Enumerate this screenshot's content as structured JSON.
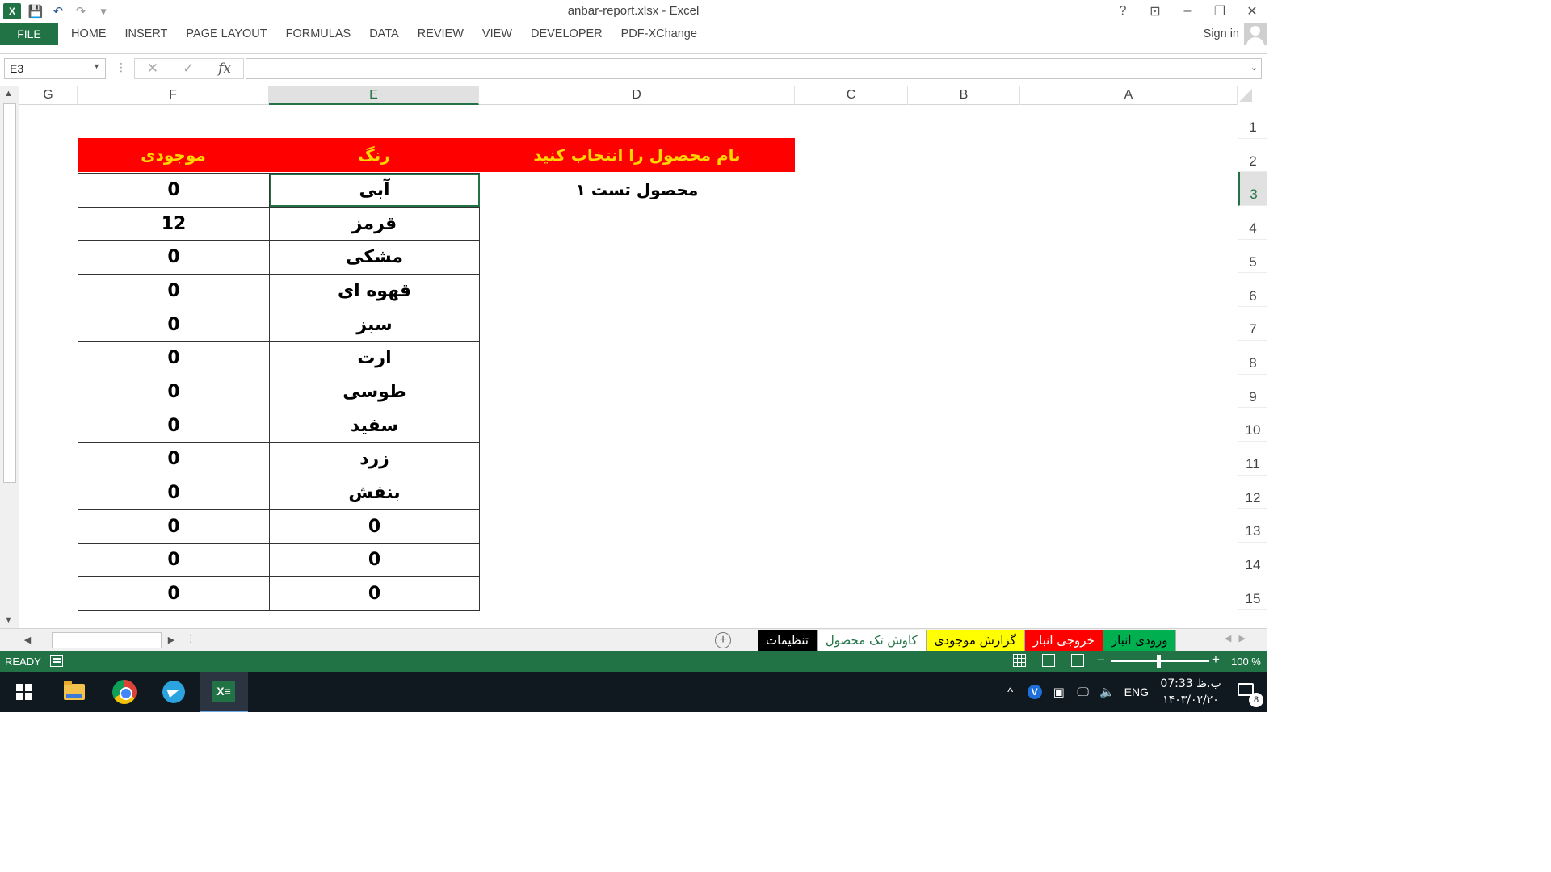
{
  "window": {
    "title": "anbar-report.xlsx - Excel",
    "help_icon": "?",
    "controls": [
      "ribbon-display-icon",
      "minimize-icon",
      "restore-icon",
      "close-icon"
    ]
  },
  "quick_access": {
    "app_icon_letter": "X",
    "save_icon": "💾",
    "undo_icon": "↶",
    "redo_icon": "↷",
    "customize_icon": "▾"
  },
  "ribbon": {
    "file_label": "FILE",
    "tabs": [
      "HOME",
      "INSERT",
      "PAGE LAYOUT",
      "FORMULAS",
      "DATA",
      "REVIEW",
      "VIEW",
      "DEVELOPER",
      "PDF-XChange"
    ],
    "signin_label": "Sign in"
  },
  "formula_bar": {
    "name_box": "E3",
    "cancel_icon": "✕",
    "enter_icon": "✓",
    "fx_label": "fx",
    "content": ""
  },
  "grid": {
    "columns": [
      {
        "name": "G"
      },
      {
        "name": "F"
      },
      {
        "name": "E"
      },
      {
        "name": "D"
      },
      {
        "name": "C"
      },
      {
        "name": "B"
      },
      {
        "name": "A"
      }
    ],
    "selected_column": "E",
    "rows": [
      "1",
      "2",
      "3",
      "4",
      "5",
      "6",
      "7",
      "8",
      "9",
      "10",
      "11",
      "12",
      "13",
      "14",
      "15"
    ],
    "selected_row": "3",
    "header_cells": {
      "stock": "موجودی",
      "color": "رنگ",
      "select_product": "نام محصول را انتخاب کنید"
    },
    "product_value": "محصول تست ۱",
    "table_rows": [
      {
        "stock": "0",
        "color": "آبی"
      },
      {
        "stock": "12",
        "color": "قرمز"
      },
      {
        "stock": "0",
        "color": "مشکی"
      },
      {
        "stock": "0",
        "color": "قهوه ای"
      },
      {
        "stock": "0",
        "color": "سبز"
      },
      {
        "stock": "0",
        "color": "ارت"
      },
      {
        "stock": "0",
        "color": "طوسی"
      },
      {
        "stock": "0",
        "color": "سفید"
      },
      {
        "stock": "0",
        "color": "زرد"
      },
      {
        "stock": "0",
        "color": "بنفش"
      },
      {
        "stock": "0",
        "color": "0"
      },
      {
        "stock": "0",
        "color": "0"
      },
      {
        "stock": "0",
        "color": "0"
      }
    ],
    "colors": {
      "header_bg": "#ff0000",
      "header_text": "#ffd700",
      "accent": "#217346"
    }
  },
  "sheet_tabs": {
    "add_icon": "+",
    "tabs": [
      {
        "label": "تنظیمات",
        "bg": "#000000",
        "fg": "#ffffff"
      },
      {
        "label": "کاوش تک محصول",
        "bg": "#ffffff",
        "fg": "#217346"
      },
      {
        "label": "گزارش موجودی",
        "bg": "#ffff00",
        "fg": "#000000"
      },
      {
        "label": "خروجی انبار",
        "bg": "#ff0000",
        "fg": "#ffffff"
      },
      {
        "label": "ورودی انبار",
        "bg": "#00b050",
        "fg": "#000000"
      }
    ]
  },
  "status_bar": {
    "ready": "READY",
    "zoom_minus": "−",
    "zoom_plus": "+",
    "zoom_level": "100 %"
  },
  "taskbar": {
    "apps": [
      "windows-start-icon",
      "file-explorer-icon",
      "chrome-icon",
      "telegram-icon",
      "excel-icon"
    ],
    "tray_chevron": "^",
    "tray_v": "V",
    "language": "ENG",
    "time": "07:33 ب.ظ",
    "date": "۱۴۰۳/۰۲/۲۰",
    "notification_count": "8"
  }
}
